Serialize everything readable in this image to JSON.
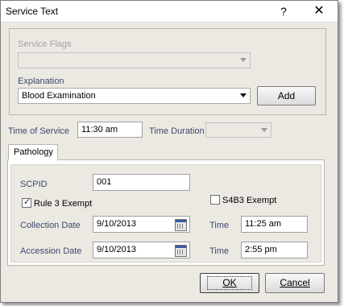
{
  "window": {
    "title": "Service Text",
    "help_label": "?",
    "close_label": "✕"
  },
  "service_flags": {
    "label": "Service Flags",
    "value": ""
  },
  "explanation": {
    "label": "Explanation",
    "value": "Blood Examination",
    "add_label": "Add"
  },
  "time_of_service": {
    "label": "Time of Service",
    "value": "11:30 am"
  },
  "time_duration": {
    "label": "Time Duration",
    "value": ""
  },
  "tabs": [
    {
      "label": "Pathology"
    }
  ],
  "pathology": {
    "scpid_label": "SCPID",
    "scpid_value": "001",
    "rule3_label": "Rule 3 Exempt",
    "rule3_checked": true,
    "s4b3_label": "S4B3 Exempt",
    "s4b3_checked": false,
    "collection_date_label": "Collection Date",
    "collection_date_value": "9/10/2013",
    "collection_time_label": "Time",
    "collection_time_value": "11:25 am",
    "accession_date_label": "Accession Date",
    "accession_date_value": "9/10/2013",
    "accession_time_label": "Time",
    "accession_time_value": "2:55 pm"
  },
  "footer": {
    "ok_label": "OK",
    "cancel_label": "Cancel"
  },
  "icons": {
    "dropdown": "chevron-down-icon",
    "calendar": "calendar-icon",
    "check": "check-icon"
  }
}
